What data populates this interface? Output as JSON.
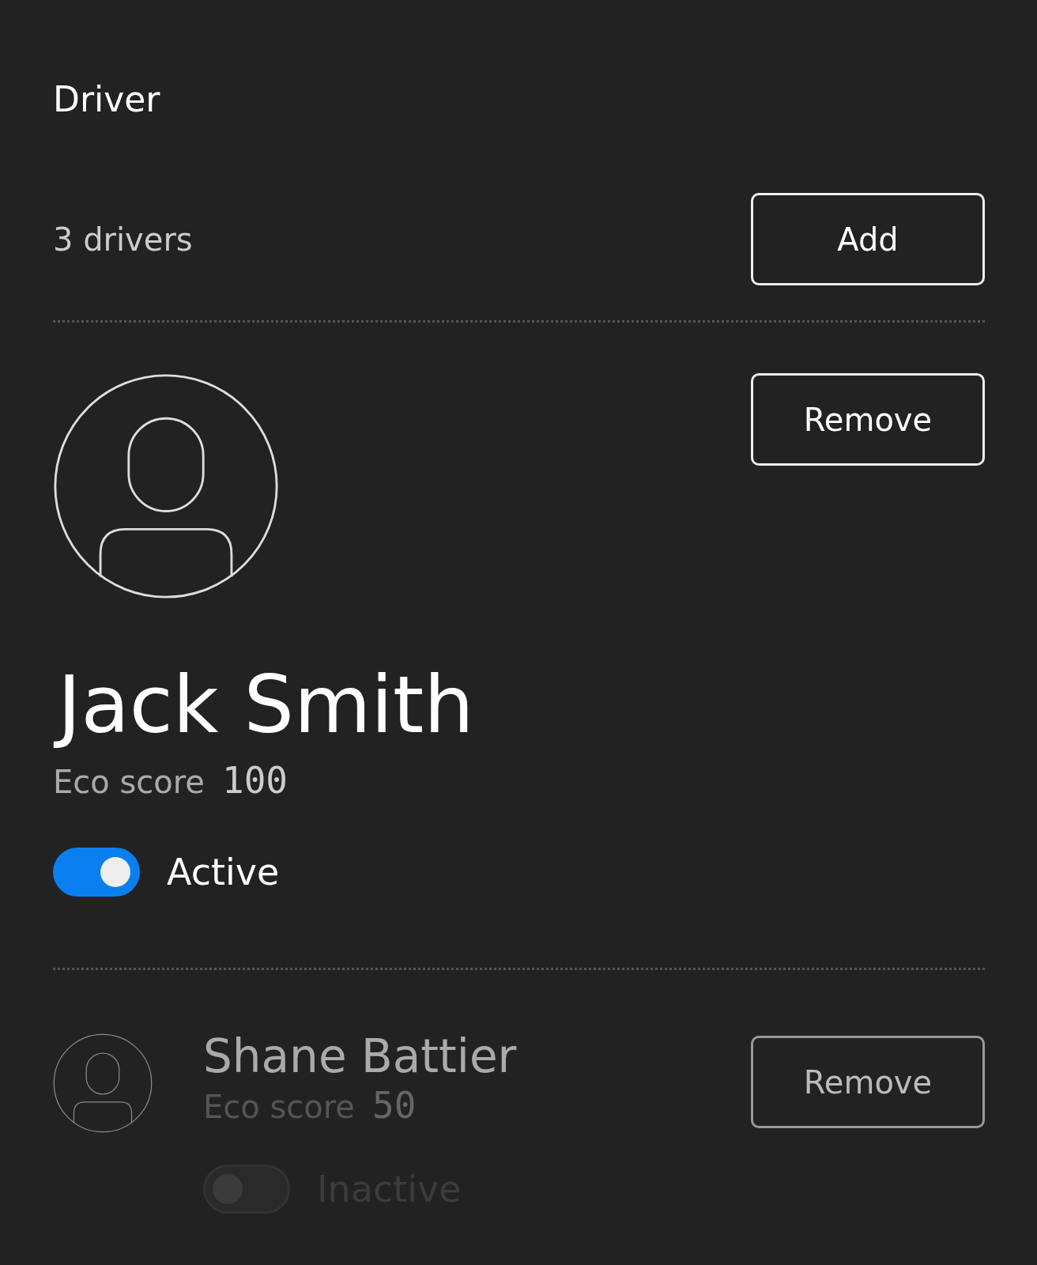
{
  "header": {
    "title": "Driver"
  },
  "summary": {
    "count": "3 drivers",
    "add_button": "Add"
  },
  "drivers": [
    {
      "name": "Jack Smith",
      "score_label": "Eco score",
      "score": "100",
      "status": "Active",
      "active": true,
      "expanded": true,
      "remove_button": "Remove"
    },
    {
      "name": "Shane Battier",
      "score_label": "Eco score",
      "score": "50",
      "status": "Inactive",
      "active": false,
      "expanded": false,
      "remove_button": "Remove"
    }
  ]
}
